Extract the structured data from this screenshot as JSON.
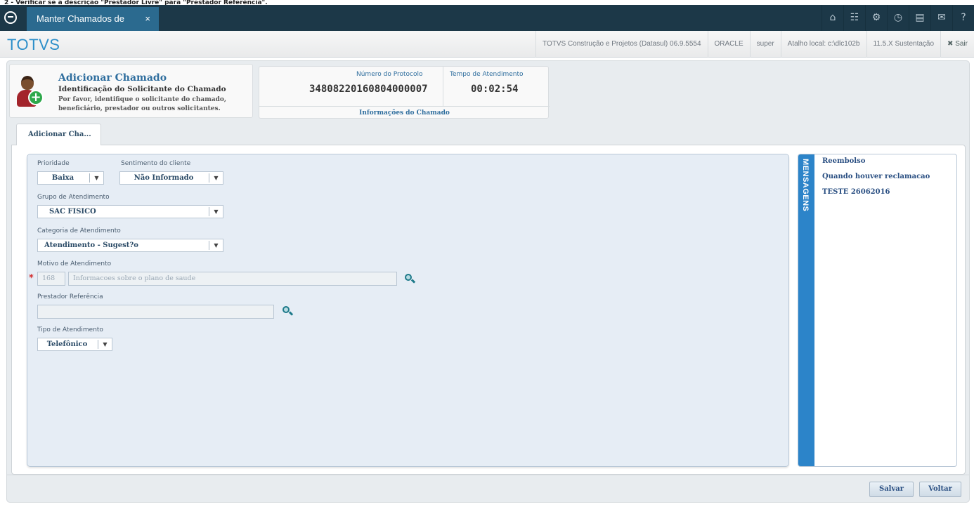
{
  "caption": "2 - Verificar se a descrição \"Prestador Livre\" para \"Prestador Referência\".",
  "topbar": {
    "tab_label": "Manter Chamados de",
    "tab_close": "×",
    "icons": [
      "home-icon",
      "sitemap-icon",
      "gear-icon",
      "clock-icon",
      "document-icon",
      "mail-icon",
      "help-icon"
    ],
    "accent": "#1c3848"
  },
  "header": {
    "brand": "TOTVS",
    "company": "TOTVS Construção e Projetos (Datasul) 06.9.5554",
    "database": "ORACLE",
    "user": "super",
    "shortcut": "Atalho local: c:\\dlc102b",
    "version": "11.5.X Sustentação",
    "exit": "✖ Sair"
  },
  "card_requester": {
    "title": "Adicionar Chamado",
    "subtitle": "Identificação do Solicitante do Chamado",
    "description": "Por favor, identifique o solicitante do chamado, beneficiário, prestador ou outros solicitantes."
  },
  "card_ticket": {
    "protocol_label": "Número do Protocolo",
    "protocol_value": "34808220160804000007",
    "time_label": "Tempo de Atendimento",
    "time_value": "00:02:54",
    "footer": "Informações do Chamado"
  },
  "form_tab": "Adicionar Cha...",
  "form": {
    "priority": {
      "label": "Prioridade",
      "value": "Baixa"
    },
    "sentiment": {
      "label": "Sentimento do cliente",
      "value": "Não Informado"
    },
    "group": {
      "label": "Grupo de Atendimento",
      "value": "SAC FISICO"
    },
    "category": {
      "label": "Categoria de Atendimento",
      "value": "Atendimento - Sugest?o"
    },
    "reason": {
      "label": "Motivo de Atendimento",
      "code": "168",
      "description": "Informacoes sobre o plano de saude",
      "required": "*"
    },
    "provider": {
      "label": "Prestador Referência",
      "value": ""
    },
    "service_type": {
      "label": "Tipo de Atendimento",
      "value": "Telefônico"
    }
  },
  "messages": {
    "title": "MENSAGENS",
    "items": [
      "Reembolso",
      "Quando houver reclamacao",
      "TESTE 26062016"
    ]
  },
  "buttons": {
    "save": "Salvar",
    "back": "Voltar"
  }
}
